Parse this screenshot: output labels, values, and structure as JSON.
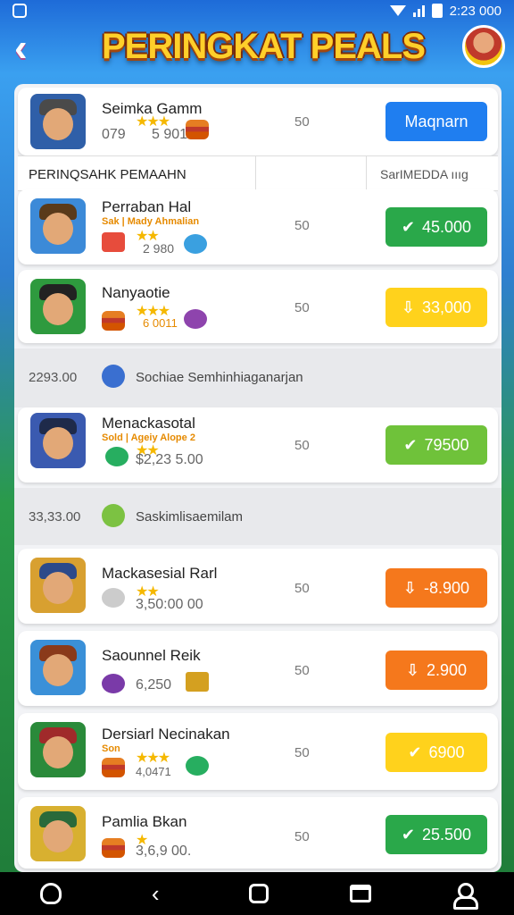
{
  "status_bar": {
    "time": "2:23 000",
    "icon_left": "app-notification-icon"
  },
  "header": {
    "title": "PERINGKAT PEALS",
    "back_icon": "back-arrow-icon"
  },
  "top_player": {
    "name": "Seimka Gamm",
    "sub": "079",
    "stars": "★★★",
    "points": "5 901",
    "score": "50",
    "button": "Maqnarn",
    "button_color": "#1f7ef0"
  },
  "table_header": {
    "col1": "PERINQSAHK PEMAAHN",
    "col2": "SarIMEDDA ıııg"
  },
  "players": [
    {
      "name": "Perraban Hal",
      "sub": "Sak | Mady Ahmalian",
      "stars": "★★",
      "points": "2 980",
      "score": "50",
      "button": "45.000",
      "icon": "check",
      "color": "#2aa84a"
    },
    {
      "name": "Nanyaotie",
      "sub": "",
      "stars": "★★★",
      "points": "6 0011",
      "score": "50",
      "button": "33,000",
      "icon": "arrow",
      "color": "#ffd21c"
    },
    {
      "name": "Menackasotal",
      "sub": "Sold | Ageiy Alope 2",
      "stars": "★★",
      "points": "$2,23 5.00",
      "score": "50",
      "button": "79500",
      "icon": "check",
      "color": "#6fc23a"
    },
    {
      "name": "Mackasesial Rarl",
      "sub": "",
      "stars": "★★",
      "points": "3,50:00 00",
      "score": "50",
      "button": "-8.900",
      "icon": "arrow",
      "color": "#f5781c"
    },
    {
      "name": "Saounnel Reik",
      "sub": "",
      "stars": "",
      "points": "6,250",
      "score": "50",
      "button": "2.900",
      "icon": "arrow",
      "color": "#f5781c"
    },
    {
      "name": "Dersiarl Necinakan",
      "sub": "Son",
      "stars": "★★★",
      "points": "4,0471",
      "score": "50",
      "button": "6900",
      "icon": "check",
      "color": "#ffd21c"
    },
    {
      "name": "Pamlia Bkan",
      "sub": "",
      "stars": "★",
      "points": "3,6,9 00.",
      "score": "50",
      "button": "25.500",
      "icon": "check",
      "color": "#2aa84a"
    }
  ],
  "sections": [
    {
      "amount": "2293.00",
      "text": "Sochiae Semhinhiaganarjan"
    },
    {
      "amount": "33,33.00",
      "text": "Saskimlisaemilam"
    }
  ],
  "navbar": {
    "icons": [
      "game-icon",
      "back-icon",
      "home-icon",
      "recents-icon",
      "profile-icon"
    ]
  }
}
